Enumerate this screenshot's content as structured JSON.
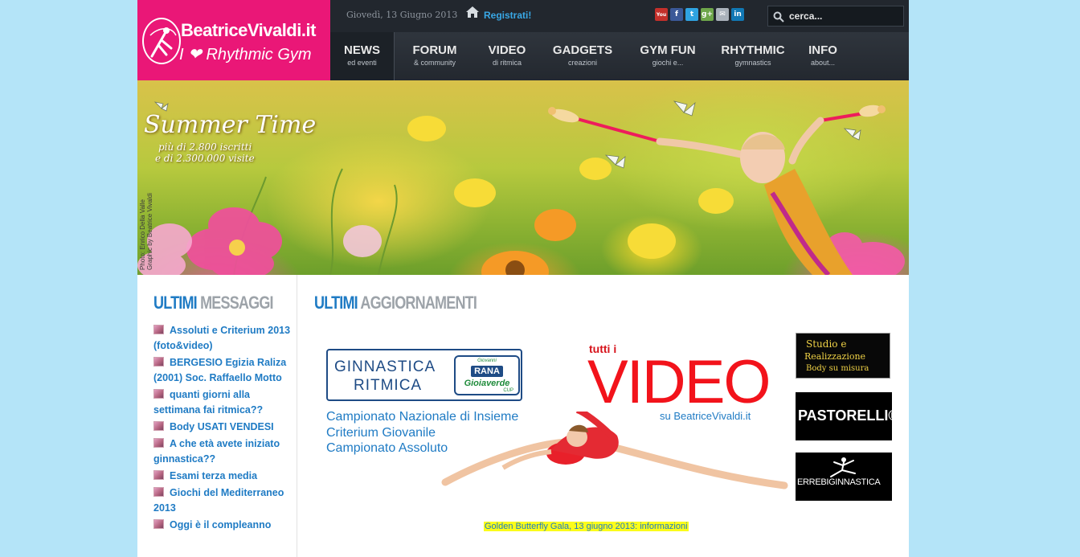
{
  "logo": {
    "line1": "BeatriceVivaldi.it",
    "line2_pre": "I",
    "line2_heart": "❤",
    "line2_post": "Rhythmic Gym"
  },
  "topbar": {
    "date": "Giovedì, 13 Giugno 2013",
    "register": "Registrati!",
    "search_placeholder": "cerca..."
  },
  "social": [
    {
      "name": "youtube",
      "glyph": "You",
      "color": "#c4302b"
    },
    {
      "name": "facebook",
      "glyph": "f",
      "color": "#3b5998"
    },
    {
      "name": "twitter",
      "glyph": "t",
      "color": "#2fa3e2"
    },
    {
      "name": "google-plus",
      "glyph": "g+",
      "color": "#6ea64b"
    },
    {
      "name": "email",
      "glyph": "✉",
      "color": "#aab2bb"
    },
    {
      "name": "linkedin",
      "glyph": "in",
      "color": "#1178b4"
    }
  ],
  "nav": [
    {
      "key": "news",
      "main": "NEWS",
      "sub": "ed eventi"
    },
    {
      "key": "forum",
      "main": "FORUM",
      "sub": "& community"
    },
    {
      "key": "video",
      "main": "VIDEO",
      "sub": "di ritmica"
    },
    {
      "key": "gadgets",
      "main": "GADGETS",
      "sub": "creazioni"
    },
    {
      "key": "gym-fun",
      "main": "GYM FUN",
      "sub": "giochi e..."
    },
    {
      "key": "rhythmic",
      "main": "RHYTHMIC",
      "sub": "gymnastics"
    },
    {
      "key": "info",
      "main": "INFO",
      "sub": "about..."
    }
  ],
  "banner": {
    "title": "Summer Time",
    "stats_line1": "più di 2.800 iscritti",
    "stats_line2": "e di 2.300.000 visite",
    "credit1": "Photo: Enrico Della Valle",
    "credit2": "Graphic by Beatrice Vivaldi"
  },
  "sidebar": {
    "title_a": "ULTIMI",
    "title_b": "MESSAGGI",
    "messages": [
      "Assoluti e Criterium 2013 (foto&video)",
      "BERGESIO Egizia Raliza (2001) Soc. Raffaello Motto",
      "quanti giorni alla settimana fai ritmica??",
      "Body USATI VENDESI",
      "A che età avete iniziato ginnastica??",
      "Esami terza media",
      "Giochi del Mediterraneo 2013",
      "Oggi è il compleanno"
    ]
  },
  "main": {
    "title_a": "ULTIMI",
    "title_b": "AGGIORNAMENTI",
    "promo": {
      "line1": "GINNASTICA",
      "line2": "RITMICA",
      "rana_top": "Giovanni",
      "rana_brand": "RANA",
      "rana_sub": "Gioiaverde",
      "rana_cup": "CUP",
      "events": [
        "Campionato Nazionale di Insieme",
        "Criterium Giovanile",
        "Campionato Assoluto"
      ]
    },
    "video": {
      "tutti": "tutti i",
      "big": "VIDEO",
      "site": "su BeatriceVivaldi.it"
    },
    "news_link": "Golden Butterfly Gala, 13 giugno 2013: informazioni"
  },
  "ads": {
    "studio_line1": "Studio e",
    "studio_line2": "Realizzazione",
    "studio_line3": "Body su misura",
    "pastorelli": "PASTORELLI®",
    "errebi": "ERREBIGINNASTICA"
  }
}
